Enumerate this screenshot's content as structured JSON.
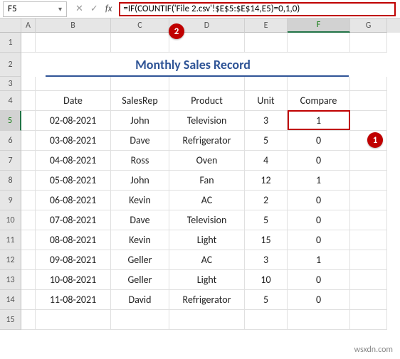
{
  "nameBox": "F5",
  "formula": "=IF(COUNTIF('File 2.csv'!$E$5:$E$14,E5)=0,1,0)",
  "columns": [
    "",
    "A",
    "B",
    "C",
    "D",
    "E",
    "F",
    "G"
  ],
  "title": "Monthly Sales Record",
  "headers": {
    "date": "Date",
    "rep": "SalesRep",
    "product": "Product",
    "unit": "Unit",
    "compare": "Compare"
  },
  "rows": [
    {
      "n": "1"
    },
    {
      "n": "2"
    },
    {
      "n": "3"
    },
    {
      "n": "4"
    },
    {
      "n": "5",
      "date": "02-08-2021",
      "rep": "John",
      "product": "Television",
      "unit": "3",
      "compare": "1"
    },
    {
      "n": "6",
      "date": "03-08-2021",
      "rep": "Dave",
      "product": "Refrigerator",
      "unit": "5",
      "compare": "0"
    },
    {
      "n": "7",
      "date": "04-08-2021",
      "rep": "Ross",
      "product": "Oven",
      "unit": "4",
      "compare": "0"
    },
    {
      "n": "8",
      "date": "05-08-2021",
      "rep": "John",
      "product": "Fan",
      "unit": "12",
      "compare": "1"
    },
    {
      "n": "9",
      "date": "06-08-2021",
      "rep": "Kevin",
      "product": "AC",
      "unit": "2",
      "compare": "0"
    },
    {
      "n": "10",
      "date": "07-08-2021",
      "rep": "Dave",
      "product": "Television",
      "unit": "5",
      "compare": "0"
    },
    {
      "n": "11",
      "date": "08-08-2021",
      "rep": "Kevin",
      "product": "Light",
      "unit": "15",
      "compare": "0"
    },
    {
      "n": "12",
      "date": "09-08-2021",
      "rep": "Geller",
      "product": "AC",
      "unit": "3",
      "compare": "1"
    },
    {
      "n": "13",
      "date": "10-08-2021",
      "rep": "Geller",
      "product": "Light",
      "unit": "10",
      "compare": "0"
    },
    {
      "n": "14",
      "date": "11-08-2021",
      "rep": "David",
      "product": "Refrigerator",
      "unit": "5",
      "compare": "0"
    },
    {
      "n": "15"
    }
  ],
  "callouts": {
    "c1": "1",
    "c2": "2"
  },
  "watermark": "wsxdn.com"
}
